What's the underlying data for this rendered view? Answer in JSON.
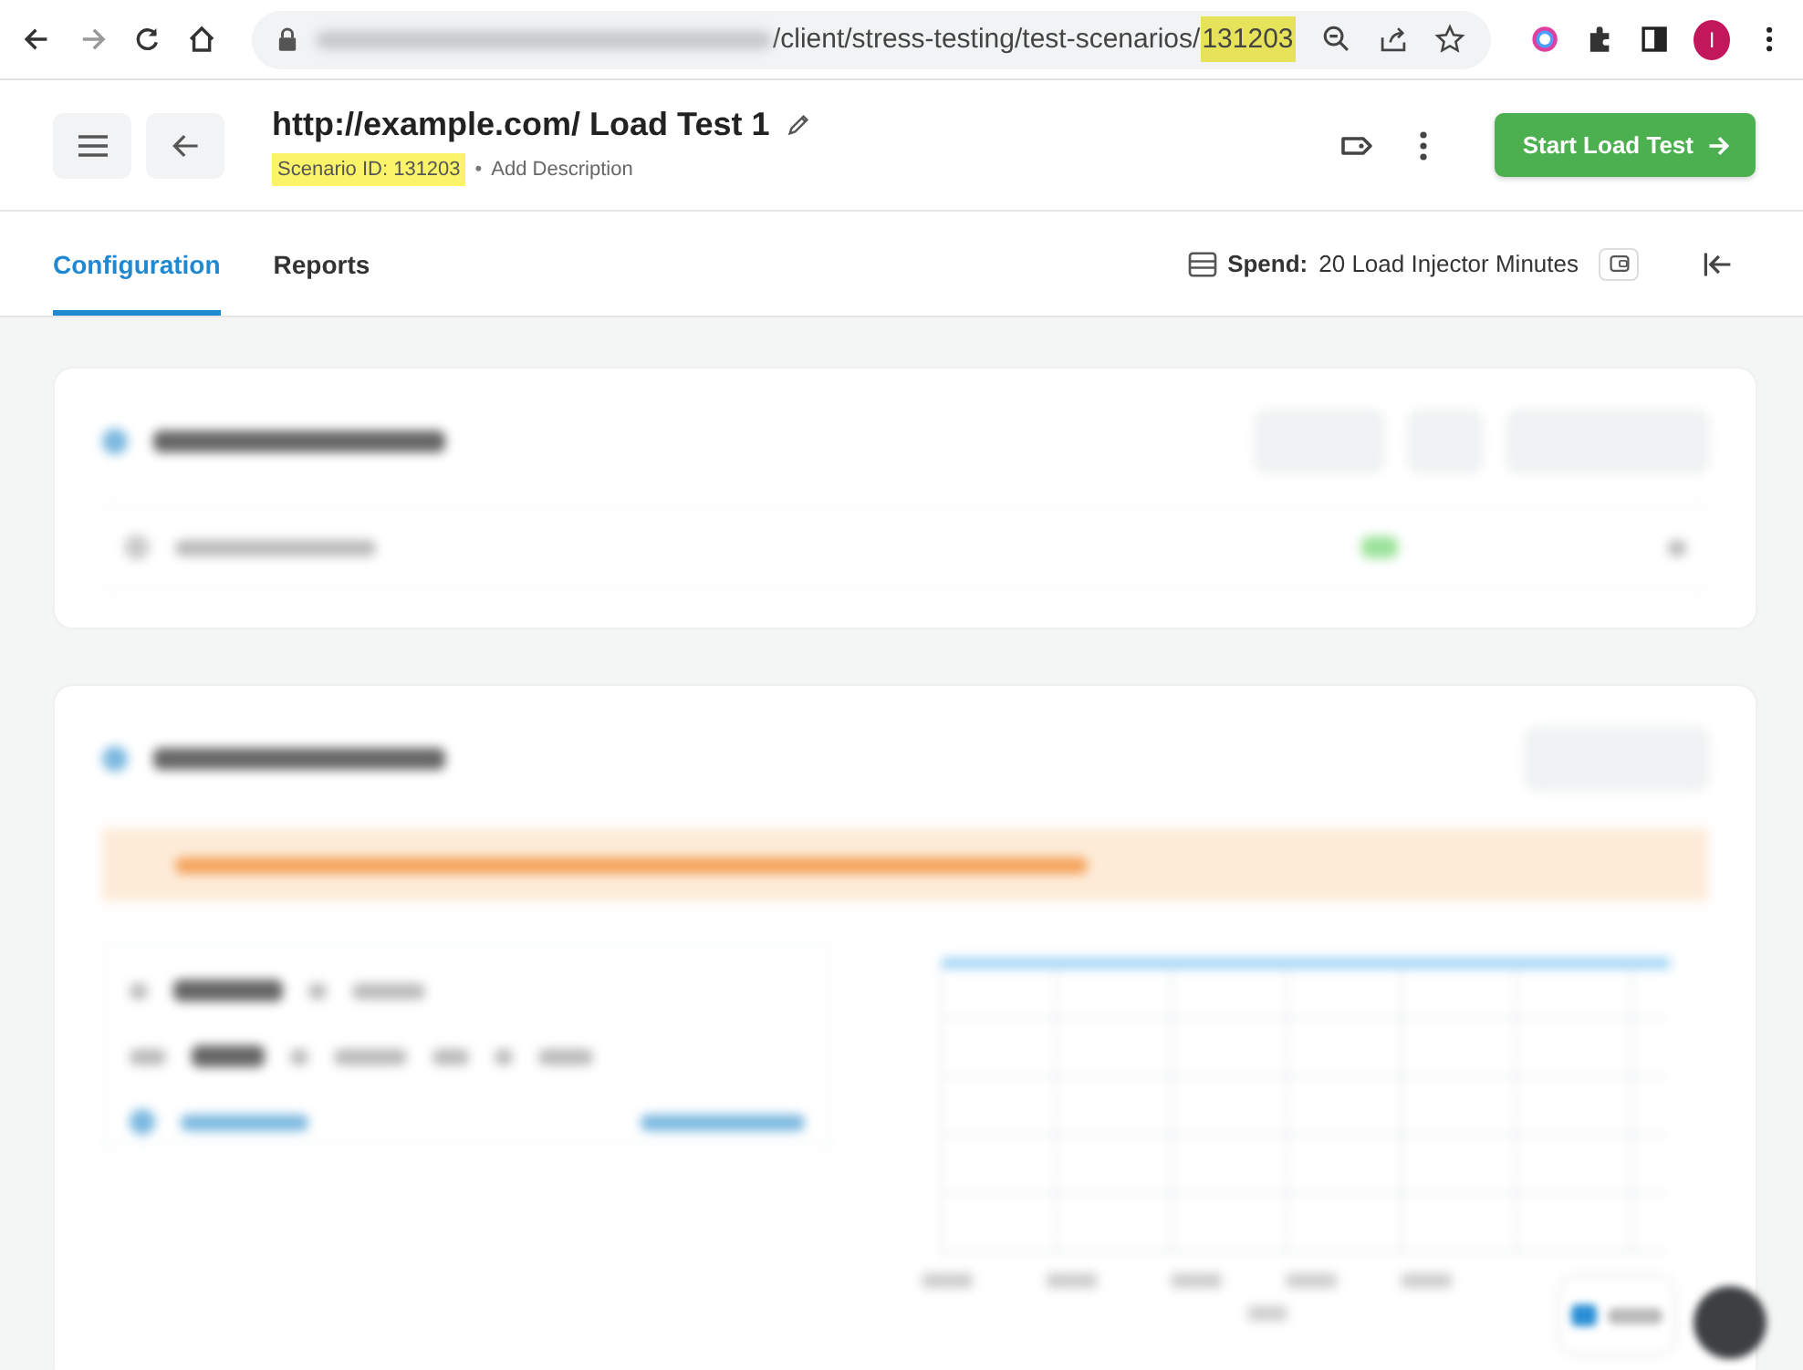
{
  "browser": {
    "url_path": "/client/stress-testing/test-scenarios/",
    "url_highlight": "131203",
    "profile_initial": "I"
  },
  "header": {
    "title": "http://example.com/ Load Test 1",
    "scenario_id": "Scenario ID: 131203",
    "separator": "•",
    "add_description": "Add Description",
    "start_button": "Start Load Test"
  },
  "tabs": [
    {
      "label": "Configuration",
      "selected": true
    },
    {
      "label": "Reports",
      "selected": false
    }
  ],
  "spend": {
    "label": "Spend:",
    "value": "20 Load Injector Minutes"
  }
}
